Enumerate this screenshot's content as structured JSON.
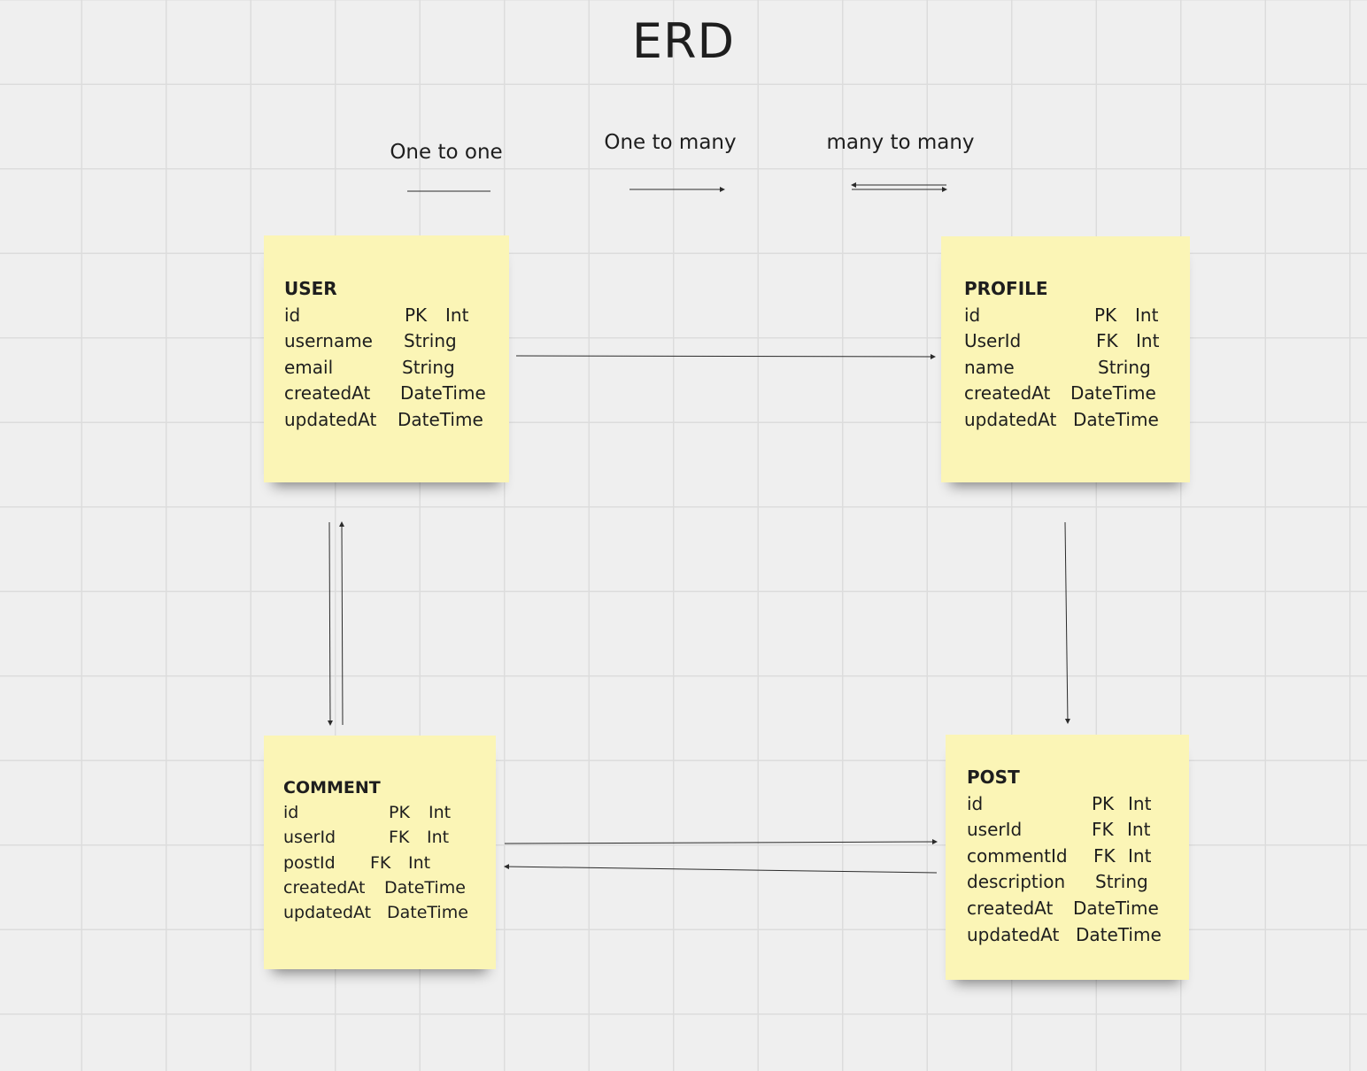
{
  "title": "ERD",
  "legend": {
    "one_to_one": "One to one",
    "one_to_many": "One to many",
    "many_to_many": "many to many"
  },
  "entities": {
    "user": {
      "name": "USER",
      "fields": [
        {
          "field": "id",
          "key": "PK",
          "type": "Int"
        },
        {
          "field": "username",
          "key": "",
          "type": "String"
        },
        {
          "field": "email",
          "key": "",
          "type": "String"
        },
        {
          "field": "createdAt",
          "key": "",
          "type": "DateTime"
        },
        {
          "field": "updatedAt",
          "key": "",
          "type": "DateTime"
        }
      ]
    },
    "profile": {
      "name": "PROFILE",
      "fields": [
        {
          "field": "id",
          "key": "PK",
          "type": "Int"
        },
        {
          "field": "UserId",
          "key": "FK",
          "type": "Int"
        },
        {
          "field": "name",
          "key": "",
          "type": "String"
        },
        {
          "field": "createdAt",
          "key": "",
          "type": "DateTime"
        },
        {
          "field": "updatedAt",
          "key": "",
          "type": "DateTime"
        }
      ]
    },
    "comment": {
      "name": "COMMENT",
      "fields": [
        {
          "field": "id",
          "key": "PK",
          "type": "Int"
        },
        {
          "field": "userId",
          "key": "FK",
          "type": "Int"
        },
        {
          "field": "postId",
          "key": "FK",
          "type": "Int"
        },
        {
          "field": "createdAt",
          "key": "",
          "type": "DateTime"
        },
        {
          "field": "updatedAt",
          "key": "",
          "type": "DateTime"
        }
      ]
    },
    "post": {
      "name": "POST",
      "fields": [
        {
          "field": "id",
          "key": "PK",
          "type": "Int"
        },
        {
          "field": "userId",
          "key": "FK",
          "type": "Int"
        },
        {
          "field": "commentId",
          "key": "FK",
          "type": "Int"
        },
        {
          "field": "description",
          "key": "",
          "type": "String"
        },
        {
          "field": "createdAt",
          "key": "",
          "type": "DateTime"
        },
        {
          "field": "updatedAt",
          "key": "",
          "type": "DateTime"
        }
      ]
    }
  },
  "colors": {
    "note": "#fbf5b6",
    "line": "#2b2b2b",
    "grid": "#dcdcdc",
    "background": "#efefef"
  }
}
